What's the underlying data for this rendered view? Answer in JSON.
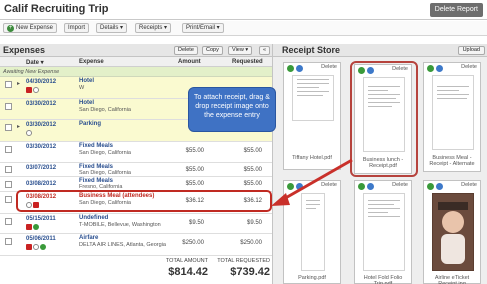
{
  "app": {
    "title": "Calif Recruiting Trip",
    "delete_report": "Delete Report"
  },
  "toolbar": {
    "new_expense": "New Expense",
    "import": "Import",
    "details": "Details ▾",
    "receipts": "Receipts ▾",
    "print_email": "Print/Email ▾"
  },
  "expenses": {
    "title": "Expenses",
    "delete": "Delete",
    "copy": "Copy",
    "view": "View ▾",
    "collapse": "«",
    "columns": {
      "date": "Date ▾",
      "expense": "Expense",
      "amount": "Amount",
      "requested": "Requested"
    },
    "awaiting": "Awaiting New Expense",
    "rows": [
      {
        "date": "04/30/2012",
        "name": "Hotel",
        "sub": "W",
        "amount": "",
        "requested": ""
      },
      {
        "date": "03/30/2012",
        "name": "Hotel",
        "sub": "San Diego, California",
        "amount": "",
        "requested": ""
      },
      {
        "date": "03/30/2012",
        "name": "Parking",
        "sub": "",
        "amount": "",
        "requested": ""
      },
      {
        "date": "03/30/2012",
        "name": "Fixed Meals",
        "sub": "San Diego, California",
        "amount": "$55.00",
        "requested": "$55.00"
      },
      {
        "date": "03/07/2012",
        "name": "Fixed Meals",
        "sub": "San Diego, California",
        "amount": "$55.00",
        "requested": "$55.00"
      },
      {
        "date": "03/08/2012",
        "name": "Fixed Meals",
        "sub": "Fresno, California",
        "amount": "$55.00",
        "requested": "$55.00"
      },
      {
        "date": "03/08/2012",
        "name": "Business Meal (attendees)",
        "sub": "San Diego, California",
        "amount": "$36.12",
        "requested": "$36.12"
      },
      {
        "date": "05/15/2011",
        "name": "Undefined",
        "sub": "T-MOBILE, Bellevue, Washington",
        "amount": "$9.50",
        "requested": "$9.50"
      },
      {
        "date": "05/06/2011",
        "name": "Airfare",
        "sub": "DELTA AIR LINES, Atlanta, Georgia",
        "amount": "$250.00",
        "requested": "$250.00"
      }
    ],
    "totals": {
      "amount_label": "TOTAL AMOUNT",
      "amount": "$814.42",
      "requested_label": "TOTAL REQUESTED",
      "requested": "$739.42"
    }
  },
  "receipt_store": {
    "title": "Receipt Store",
    "upload": "Upload",
    "delete_label": "Delete",
    "cards": [
      {
        "caption": "Tiffany Hotel.pdf"
      },
      {
        "caption": "Business lunch - Receipt.pdf"
      },
      {
        "caption": "Business Meal - Receipt - Alternate"
      },
      {
        "caption": "Parking.pdf"
      },
      {
        "caption": "Hotel Fold Folio Trip.pdf"
      },
      {
        "caption": "Airline eTicket Receipt.jpg"
      }
    ]
  },
  "tooltip": {
    "text": "To attach receipt, drag & drop receipt image onto the expense entry"
  },
  "colors": {
    "accent_blue": "#3f72c4",
    "highlight_red": "#c02a22",
    "awaiting_green": "#e3f0c9"
  }
}
